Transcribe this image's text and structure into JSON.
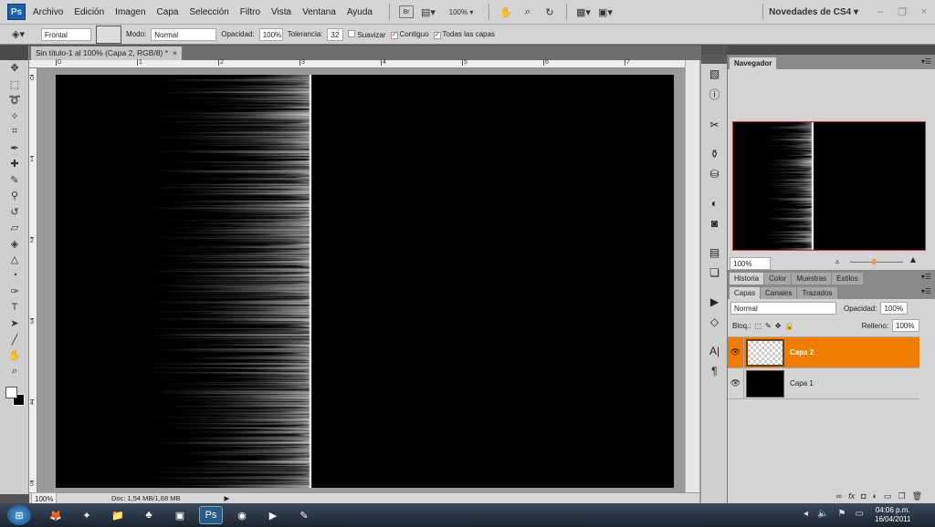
{
  "menubar": {
    "logo": "Ps",
    "items": [
      "Archivo",
      "Edición",
      "Imagen",
      "Capa",
      "Selección",
      "Filtro",
      "Vista",
      "Ventana",
      "Ayuda"
    ],
    "bridge": "Br",
    "zoom": "100%",
    "workspace": "Novedades de CS4"
  },
  "options": {
    "fill_source": "Frontal",
    "mode_label": "Modo:",
    "mode": "Normal",
    "opacity_label": "Opacidad:",
    "opacity": "100%",
    "tolerance_label": "Tolerancia:",
    "tolerance": "32",
    "antialias": "Suavizar",
    "contiguous": "Contiguo",
    "all_layers": "Todas las capas"
  },
  "document": {
    "tab_title": "Sin título-1 al 100% (Capa 2, RGB/8) *",
    "close": "×",
    "h_ruler": [
      "0",
      "1",
      "2",
      "3",
      "4",
      "5",
      "6",
      "7"
    ],
    "v_ruler": [
      "0",
      "1",
      "2",
      "3",
      "4",
      "5"
    ]
  },
  "status": {
    "zoom": "100%",
    "doc": "Doc: 1,54 MB/1,68 MB"
  },
  "navigator": {
    "title": "Navegador",
    "zoom": "100%"
  },
  "tabs_group1": [
    "Historia",
    "Color",
    "Muestras",
    "Estilos"
  ],
  "layers_panel": {
    "tabs": [
      "Capas",
      "Canales",
      "Trazados"
    ],
    "blend": "Normal",
    "opacity_label": "Opacidad:",
    "opacity": "100%",
    "lock_label": "Bloq.:",
    "fill_label": "Relleno:",
    "fill": "100%",
    "layers": [
      {
        "name": "Capa 2",
        "selected": true
      },
      {
        "name": "Capa 1",
        "selected": false
      }
    ]
  },
  "taskbar": {
    "time": "04:06 p.m.",
    "date": "16/04/2011"
  },
  "colors": {
    "accent": "#f07c00"
  }
}
